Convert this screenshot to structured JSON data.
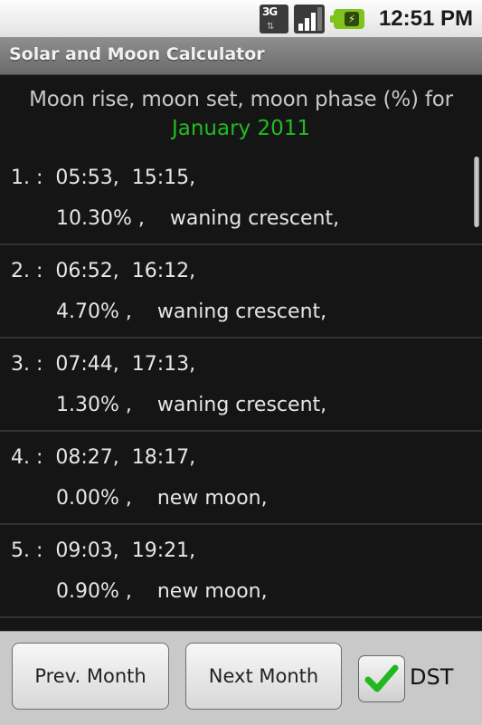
{
  "status_bar": {
    "network_label": "3G",
    "network_icon": "3g-data-icon",
    "signal_icon": "signal-strength-icon",
    "signal_level": 0.8,
    "battery_icon": "battery-charging-icon",
    "battery_symbol": "⚡",
    "time": "12:51 PM"
  },
  "app": {
    "title": "Solar and Moon Calculator"
  },
  "header": {
    "description": "Moon rise, moon set, moon phase (%) for",
    "month": "January 2011",
    "month_color": "#22bb22"
  },
  "entries": [
    {
      "day": "1. :",
      "rise": "05:53,",
      "set": "15:15,",
      "line1": "1. :  05:53,  15:15,",
      "line2": "10.30% ,    waning crescent,",
      "percent": "10.30%",
      "phase": "waning crescent"
    },
    {
      "day": "2. :",
      "rise": "06:52,",
      "set": "16:12,",
      "line1": "2. :  06:52,  16:12,",
      "line2": "4.70% ,    waning crescent,",
      "percent": "4.70%",
      "phase": "waning crescent"
    },
    {
      "day": "3. :",
      "rise": "07:44,",
      "set": "17:13,",
      "line1": "3. :  07:44,  17:13,",
      "line2": "1.30% ,    waning crescent,",
      "percent": "1.30%",
      "phase": "waning crescent"
    },
    {
      "day": "4. :",
      "rise": "08:27,",
      "set": "18:17,",
      "line1": "4. :  08:27,  18:17,",
      "line2": "0.00% ,    new moon,",
      "percent": "0.00%",
      "phase": "new moon"
    },
    {
      "day": "5. :",
      "rise": "09:03,",
      "set": "19:21,",
      "line1": "5. :  09:03,  19:21,",
      "line2": "0.90% ,    new moon,",
      "percent": "0.90%",
      "phase": "new moon"
    }
  ],
  "footer": {
    "prev_label": "Prev. Month",
    "next_label": "Next Month",
    "dst_label": "DST",
    "dst_checked": true,
    "check_color": "#1fb81f"
  }
}
